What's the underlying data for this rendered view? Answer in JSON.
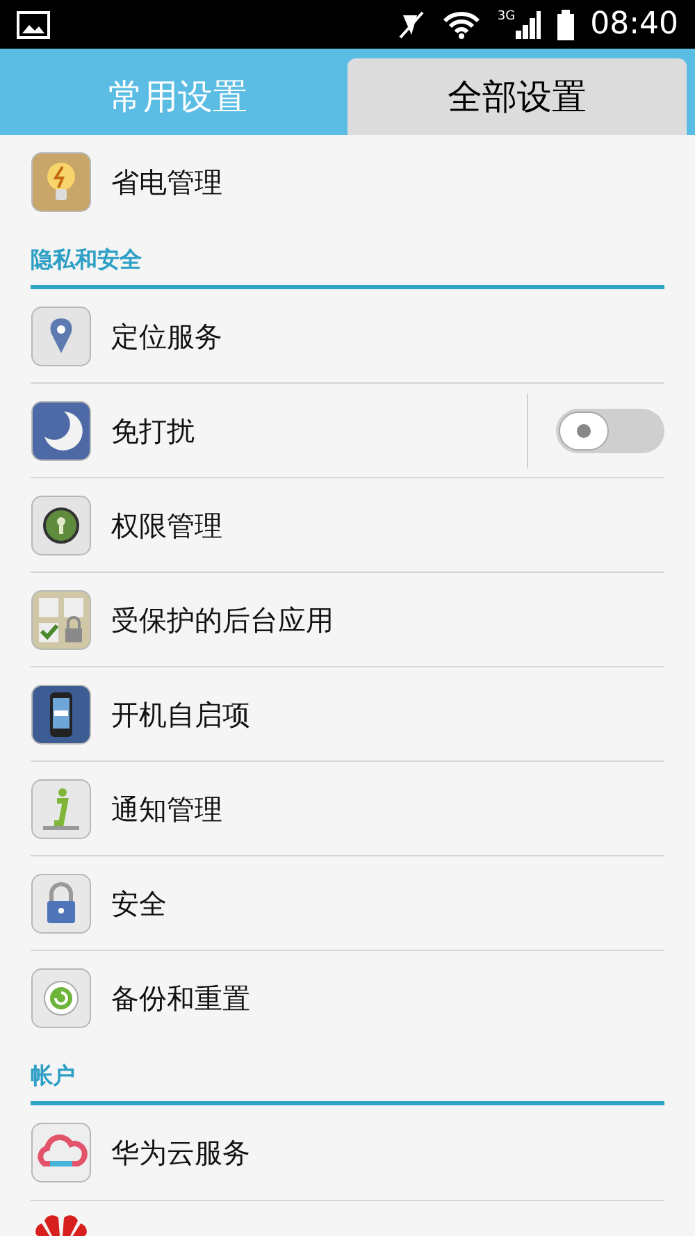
{
  "status_bar": {
    "time": "08:40",
    "network": "3G"
  },
  "tabs": [
    {
      "label": "常用设置",
      "selected": false
    },
    {
      "label": "全部设置",
      "selected": true
    }
  ],
  "groups": [
    {
      "items": [
        {
          "label": "省电管理",
          "kind": "link"
        }
      ]
    },
    {
      "title": "隐私和安全",
      "items": [
        {
          "label": "定位服务",
          "kind": "link"
        },
        {
          "label": "免打扰",
          "kind": "toggle",
          "on": false
        },
        {
          "label": "权限管理",
          "kind": "link"
        },
        {
          "label": "受保护的后台应用",
          "kind": "link"
        },
        {
          "label": "开机自启项",
          "kind": "link"
        },
        {
          "label": "通知管理",
          "kind": "link"
        },
        {
          "label": "安全",
          "kind": "link"
        },
        {
          "label": "备份和重置",
          "kind": "link"
        }
      ]
    },
    {
      "title": "帐户",
      "items": [
        {
          "label": "华为云服务",
          "kind": "link"
        }
      ]
    }
  ]
}
